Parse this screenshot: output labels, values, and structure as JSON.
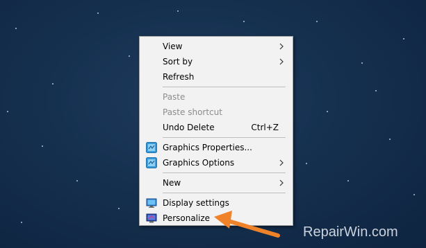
{
  "context_menu": {
    "view": "View",
    "sort_by": "Sort by",
    "refresh": "Refresh",
    "paste": "Paste",
    "paste_shortcut": "Paste shortcut",
    "undo_delete": "Undo Delete",
    "undo_delete_shortcut": "Ctrl+Z",
    "graphics_properties": "Graphics Properties...",
    "graphics_options": "Graphics Options",
    "new": "New",
    "display_settings": "Display settings",
    "personalize": "Personalize"
  },
  "watermark": "RepairWin.com",
  "colors": {
    "desktop": "#15304f",
    "menu_bg": "#f2f2f2",
    "arrow_annotation": "#f0822a"
  },
  "icons": {
    "graphics_properties": "intel-graphics-icon",
    "graphics_options": "intel-graphics-icon",
    "display_settings": "monitor-icon",
    "personalize": "personalize-icon"
  }
}
